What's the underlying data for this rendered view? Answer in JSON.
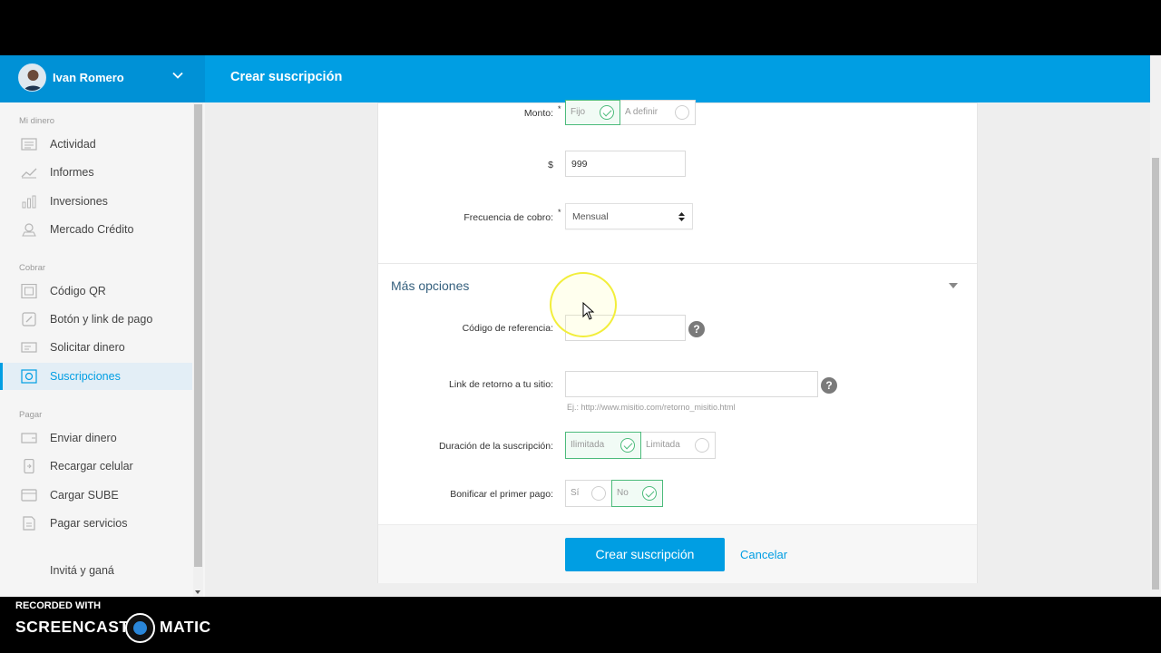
{
  "header": {
    "user_name": "Ivan Romero",
    "page_title": "Crear suscripción",
    "brand_color": "#009ee3"
  },
  "sidebar": {
    "sections": [
      {
        "title": "Mi dinero"
      },
      {
        "title": "Cobrar"
      },
      {
        "title": "Pagar"
      }
    ],
    "items": [
      {
        "label": "Actividad",
        "icon": "list-icon"
      },
      {
        "label": "Informes",
        "icon": "chart-line-icon"
      },
      {
        "label": "Inversiones",
        "icon": "bar-chart-icon"
      },
      {
        "label": "Mercado Crédito",
        "icon": "credit-icon"
      },
      {
        "label": "Código QR",
        "icon": "qr-code-icon"
      },
      {
        "label": "Botón y link de pago",
        "icon": "link-icon"
      },
      {
        "label": "Solicitar dinero",
        "icon": "request-money-icon"
      },
      {
        "label": "Suscripciones",
        "icon": "subscriptions-icon",
        "active": true
      },
      {
        "label": "Enviar dinero",
        "icon": "send-money-icon"
      },
      {
        "label": "Recargar celular",
        "icon": "phone-recharge-icon"
      },
      {
        "label": "Cargar SUBE",
        "icon": "card-icon"
      },
      {
        "label": "Pagar servicios",
        "icon": "bill-icon"
      },
      {
        "label": "Invitá y ganá"
      }
    ]
  },
  "form": {
    "monto": {
      "label": "Monto:",
      "required_mark": "*",
      "options": [
        "Fijo",
        "A definir"
      ],
      "selected": "Fijo"
    },
    "amount": {
      "currency": "$",
      "value": "999"
    },
    "frecuencia": {
      "label": "Frecuencia de cobro:",
      "required_mark": "*",
      "value": "Mensual"
    },
    "mas_opciones": {
      "title": "Más opciones"
    },
    "codigo_referencia": {
      "label": "Código de referencia:",
      "value": "",
      "help": "?"
    },
    "link_retorno": {
      "label": "Link de retorno a tu sitio:",
      "value": "",
      "hint": "Ej.: http://www.misitio.com/retorno_misitio.html",
      "help": "?"
    },
    "duracion": {
      "label": "Duración de la suscripción:",
      "options": [
        "Ilimitada",
        "Limitada"
      ],
      "selected": "Ilimitada"
    },
    "bonificar": {
      "label": "Bonificar el primer pago:",
      "options": [
        "Sí",
        "No"
      ],
      "selected": "No"
    }
  },
  "actions": {
    "submit": "Crear suscripción",
    "cancel": "Cancelar"
  },
  "watermark": {
    "recorded_with": "RECORDED WITH",
    "brand_left": "SCREENCAST",
    "brand_right": "MATIC"
  }
}
